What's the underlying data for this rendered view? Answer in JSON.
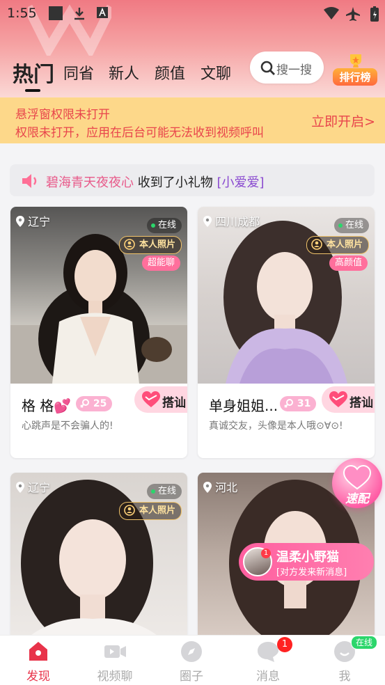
{
  "status_bar": {
    "time": "1:55"
  },
  "tabs": [
    {
      "label": "热门",
      "active": true
    },
    {
      "label": "同省"
    },
    {
      "label": "新人"
    },
    {
      "label": "颜值"
    },
    {
      "label": "文聊"
    }
  ],
  "search": {
    "label": "搜一搜"
  },
  "ranking": {
    "label": "排行榜"
  },
  "warning": {
    "line1": "悬浮窗权限未打开",
    "line2": "权限未打开，应用在后台可能无法收到视频呼叫",
    "action": "立即开启>"
  },
  "notice": {
    "sender": "碧海青天夜夜心",
    "text": " 收到了小礼物 ",
    "gift": "[小爱爱]"
  },
  "cards": [
    {
      "location": "辽宁",
      "online": "在线",
      "verified": "本人照片",
      "tag": "超能聊",
      "nickname": "格 格💕",
      "level": "25",
      "greet": "搭讪",
      "bio": "心跳声是不会骗人的!"
    },
    {
      "location": "四川成都",
      "online": "在线",
      "verified": "本人照片",
      "tag": "高颜值",
      "nickname": "单身姐姐...",
      "level": "31",
      "greet": "搭讪",
      "bio": "真诚交友，头像是本人哦⊙∀⊙!"
    },
    {
      "location": "辽宁",
      "online": "在线",
      "verified": "本人照片"
    },
    {
      "location": "河北"
    }
  ],
  "speed_match": {
    "label": "速配"
  },
  "message_popup": {
    "name": "温柔小野猫",
    "text": "[对方发来新消息]",
    "count": "1"
  },
  "nav": [
    {
      "label": "发现",
      "active": true
    },
    {
      "label": "视频聊"
    },
    {
      "label": "圈子"
    },
    {
      "label": "消息",
      "badge": "1"
    },
    {
      "label": "我",
      "status": "在线"
    }
  ],
  "colors": {
    "accent": "#e8334a",
    "pink": "#ff6f9c",
    "warn_bg": "#fdd88a"
  }
}
